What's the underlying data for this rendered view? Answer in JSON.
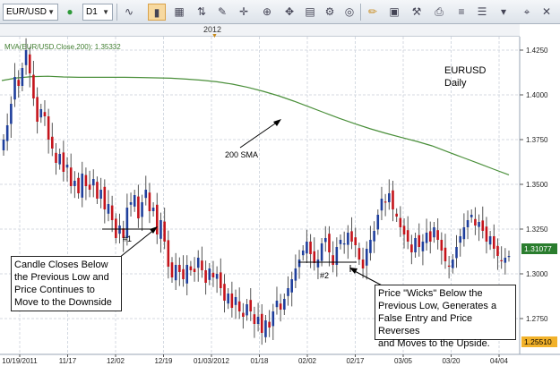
{
  "toolbar": {
    "symbol": "EUR/USD",
    "timeframe": "D1",
    "icons": [
      "status-dot-icon",
      "caret-down-icon",
      "bar-chart-icon",
      "candlestick-icon",
      "line-chart-icon",
      "indicators-icon",
      "drawing-icon",
      "crosshair-icon",
      "grid-icon",
      "zoom-icon",
      "hand-icon",
      "pencil-icon",
      "image-icon",
      "settings-icon",
      "print-icon",
      "more-icon"
    ]
  },
  "topaxis": {
    "year_label": "2012"
  },
  "indicator_label": "MVA(EUR/USD.Close,200): 1.35332",
  "chart_title_line1": "EURUSD",
  "chart_title_line2": "Daily",
  "sma_label": "200 SMA",
  "marker1": "#1",
  "marker2": "#2",
  "note1": [
    "Candle Closes Below",
    "the Previous Low and",
    "Price Continues to",
    "Move to the Downside"
  ],
  "note2": [
    "Price \"Wicks\" Below the",
    "Previous Low, Generates a",
    "False Entry and Price Reverses",
    "and Moves to the Upside."
  ],
  "price_tag": "1.31077",
  "bottom_tag": "1.25510",
  "colors": {
    "up": "#1f3f9c",
    "down": "#c4141b",
    "sma": "#4a8f3a",
    "grid": "#d4dae2"
  },
  "chart_data": {
    "type": "candlestick",
    "x_tick_labels": [
      "10/19/2011",
      "11/17",
      "12/02",
      "12/19",
      "01/03/2012",
      "01/18",
      "02/02",
      "02/17",
      "03/05",
      "03/20",
      "04/04"
    ],
    "y_tick_labels": [
      "1.4250",
      "1.4000",
      "1.3750",
      "1.3500",
      "1.3250",
      "1.3000",
      "1.2750"
    ],
    "ylim": [
      1.255,
      1.4325
    ],
    "grid": true,
    "closes": [
      1.375,
      1.383,
      1.395,
      1.41,
      1.405,
      1.415,
      1.425,
      1.412,
      1.398,
      1.385,
      1.392,
      1.388,
      1.375,
      1.37,
      1.362,
      1.367,
      1.357,
      1.361,
      1.349,
      1.352,
      1.345,
      1.356,
      1.349,
      1.347,
      1.353,
      1.342,
      1.347,
      1.336,
      1.339,
      1.33,
      1.32,
      1.327,
      1.32,
      1.337,
      1.34,
      1.344,
      1.331,
      1.34,
      1.347,
      1.335,
      1.337,
      1.322,
      1.33,
      1.318,
      1.304,
      1.298,
      1.305,
      1.301,
      1.297,
      1.305,
      1.302,
      1.301,
      1.309,
      1.302,
      1.295,
      1.303,
      1.298,
      1.3,
      1.292,
      1.285,
      1.289,
      1.281,
      1.287,
      1.279,
      1.276,
      1.283,
      1.279,
      1.272,
      1.276,
      1.267,
      1.274,
      1.27,
      1.279,
      1.285,
      1.28,
      1.286,
      1.292,
      1.297,
      1.303,
      1.308,
      1.313,
      1.318,
      1.311,
      1.306,
      1.308,
      1.317,
      1.32,
      1.312,
      1.305,
      1.315,
      1.319,
      1.317,
      1.323,
      1.318,
      1.316,
      1.308,
      1.303,
      1.314,
      1.319,
      1.324,
      1.333,
      1.342,
      1.34,
      1.345,
      1.336,
      1.332,
      1.326,
      1.322,
      1.318,
      1.312,
      1.32,
      1.315,
      1.318,
      1.323,
      1.318,
      1.326,
      1.319,
      1.313,
      1.307,
      1.304,
      1.308,
      1.315,
      1.321,
      1.326,
      1.33,
      1.333,
      1.327,
      1.329,
      1.324,
      1.318,
      1.321,
      1.314,
      1.31,
      1.307,
      1.309,
      1.31
    ],
    "sma": [
      1.408,
      1.4095,
      1.4102,
      1.4104,
      1.41,
      1.4098,
      1.4098,
      1.4098,
      1.4098,
      1.4097,
      1.4095,
      1.4093,
      1.4088,
      1.4082,
      1.4073,
      1.406,
      1.4042,
      1.402,
      1.3995,
      1.3965,
      1.3933,
      1.39,
      1.3868,
      1.3838,
      1.381,
      1.3785,
      1.3762,
      1.374,
      1.3715,
      1.3682,
      1.365,
      1.3618,
      1.3585,
      1.3553
    ],
    "annotations": [
      "200 SMA",
      "#1",
      "#2",
      "EURUSD",
      "Daily"
    ]
  }
}
